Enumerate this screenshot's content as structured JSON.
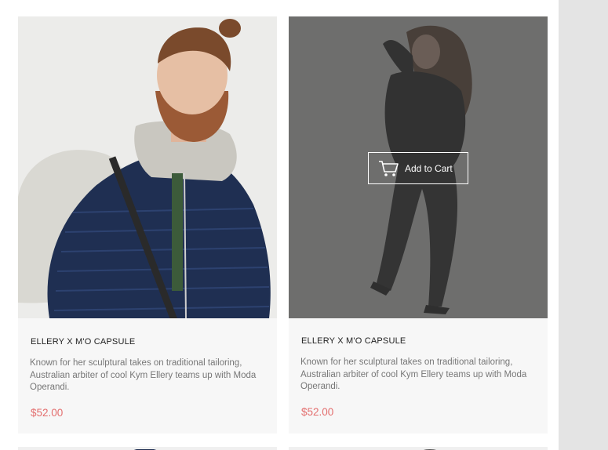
{
  "products": [
    {
      "title": "ELLERY X M'O CAPSULE",
      "description": "Known for her sculptural takes on traditional tailoring, Australian arbiter of cool Kym Ellery teams up with Moda Operandi.",
      "price": "$52.00",
      "image": "man-in-puffer-jacket-photo"
    },
    {
      "title": "ELLERY X M'O CAPSULE",
      "description": "Known for her sculptural takes on traditional tailoring, Australian arbiter of cool Kym Ellery teams up with Moda Operandi.",
      "price": "$52.00",
      "image": "woman-in-black-suit-photo",
      "hover_action": {
        "label": "Add to Cart",
        "icon": "cart-icon"
      }
    }
  ],
  "colors": {
    "price": "#e36e6e",
    "overlay": "#3c3c3c",
    "card_bg": "#f7f7f7"
  }
}
